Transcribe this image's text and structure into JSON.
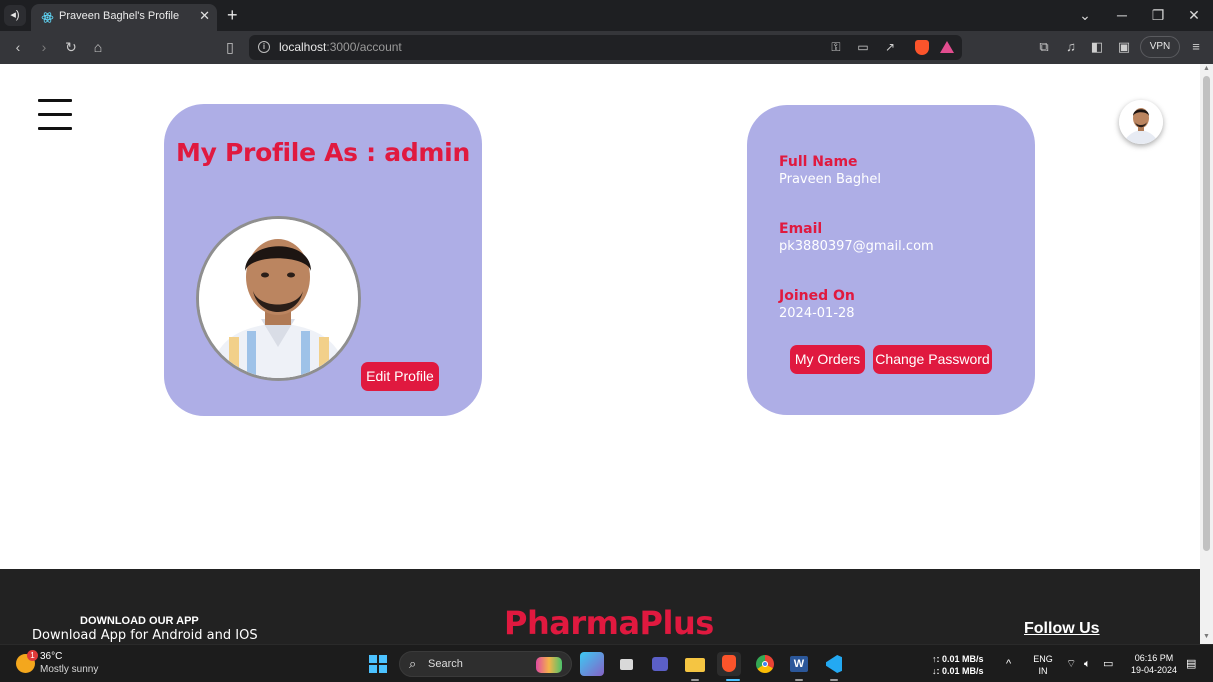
{
  "browser": {
    "tab_title": "Praveen Baghel's Profile",
    "url_host": "localhost",
    "url_path": ":3000/account",
    "vpn_label": "VPN",
    "new_tab_glyph": "+",
    "close_tab_glyph": "✕"
  },
  "page": {
    "profile_heading": "My Profile As : admin",
    "edit_button": "Edit Profile",
    "fields": [
      {
        "label": "Full Name",
        "value": "Praveen Baghel"
      },
      {
        "label": "Email",
        "value": "pk3880397@gmail.com"
      },
      {
        "label": "Joined On",
        "value": "2024-01-28"
      }
    ],
    "orders_button": "My Orders",
    "password_button": "Change Password"
  },
  "footer": {
    "download_title": "DOWNLOAD OUR APP",
    "download_sub": "Download App for Android and IOS",
    "brand": "PharmaPlus",
    "follow": "Follow Us"
  },
  "taskbar": {
    "temperature": "36°C",
    "weather": "Mostly sunny",
    "weather_badge": "1",
    "search_label": "Search",
    "upload_speed": "↑: 0.01 MB/s",
    "download_speed": "↓: 0.01 MB/s",
    "language": "ENG",
    "region": "IN",
    "time": "06:16 PM",
    "date": "19-04-2024"
  },
  "colors": {
    "accent": "#e0193f",
    "card": "#aeaee6",
    "footer": "#222222"
  },
  "icons": [
    "speaker-icon",
    "react-favicon-icon",
    "back-icon",
    "forward-icon",
    "reload-icon",
    "home-icon",
    "bookmark-icon",
    "key-icon",
    "cast-icon",
    "share-icon",
    "brave-shields-icon",
    "brave-rewards-icon",
    "extensions-icon",
    "media-icon",
    "sidebar-icon",
    "wallet-icon",
    "menu-icon",
    "hamburger-icon",
    "windows-start-icon",
    "search-icon",
    "wifi-icon",
    "volume-icon",
    "battery-icon",
    "notification-icon"
  ]
}
